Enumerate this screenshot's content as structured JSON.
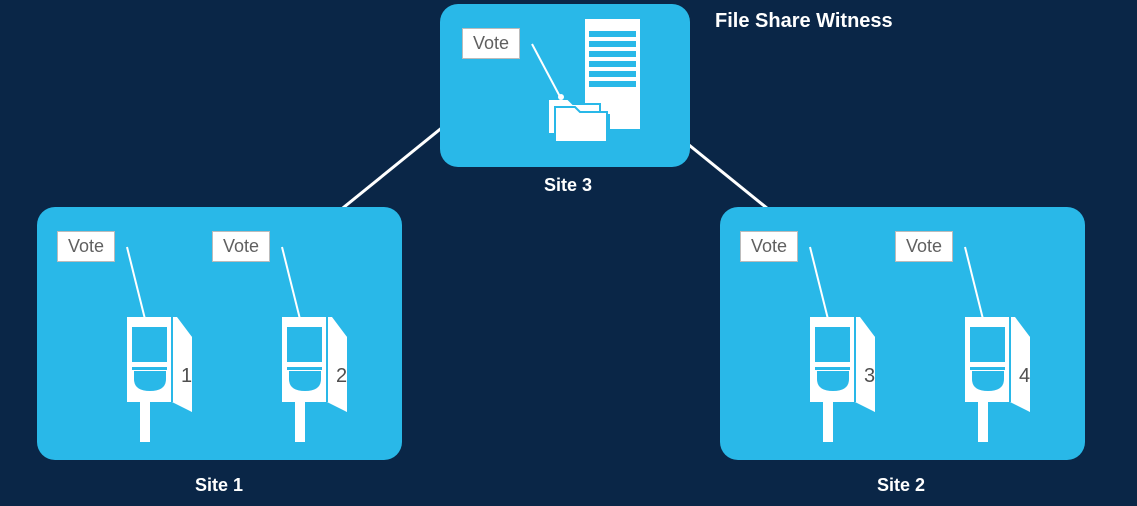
{
  "title": "File Share Witness",
  "sites": {
    "site3": {
      "label": "Site 3",
      "vote": "Vote"
    },
    "site1": {
      "label": "Site 1",
      "nodes": [
        {
          "vote": "Vote",
          "num": "1"
        },
        {
          "vote": "Vote",
          "num": "2"
        }
      ]
    },
    "site2": {
      "label": "Site 2",
      "nodes": [
        {
          "vote": "Vote",
          "num": "3"
        },
        {
          "vote": "Vote",
          "num": "4"
        }
      ]
    }
  }
}
